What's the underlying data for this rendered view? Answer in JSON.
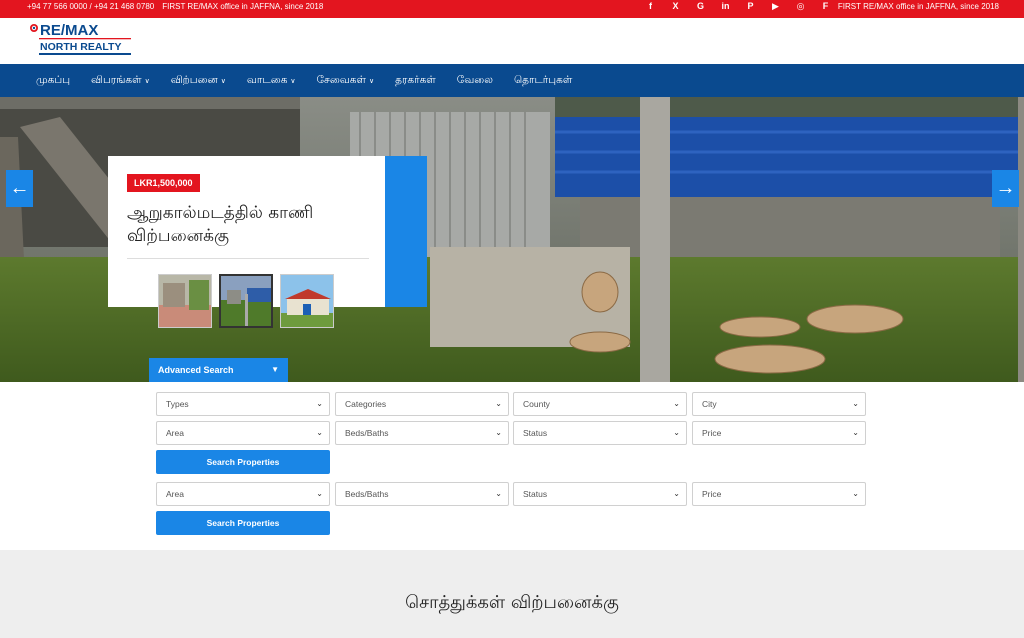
{
  "topbar": {
    "phones": "+94 77 566 0000 / +94 21 468 0780",
    "tagline_left": "FIRST RE/MAX office in JAFFNA, since 2018",
    "tagline_right": "FIRST RE/MAX office in JAFFNA, since 2018",
    "social": [
      "f",
      "X",
      "G",
      "in",
      "P",
      "▶",
      "◎",
      "F"
    ]
  },
  "logo": {
    "line1": "RE/MAX",
    "line2": "NORTH REALTY"
  },
  "nav": {
    "items": [
      {
        "label": "முகப்பு",
        "caret": false
      },
      {
        "label": "விபரங்கள்",
        "caret": true
      },
      {
        "label": "விற்பனை",
        "caret": true
      },
      {
        "label": "வாடகை",
        "caret": true
      },
      {
        "label": "சேவைகள்",
        "caret": true
      },
      {
        "label": "தரகர்கள்",
        "caret": false
      },
      {
        "label": "வேலை",
        "caret": false
      },
      {
        "label": "தொடர்புகள்",
        "caret": false
      }
    ]
  },
  "hero": {
    "price": "LKR1,500,000",
    "title": "ஆறுகால்மடத்தில் காணி விற்பனைக்கு",
    "prev_icon": "arrow-left-icon",
    "next_icon": "arrow-right-icon"
  },
  "search": {
    "toggle_label": "Advanced Search",
    "row1": [
      "Types",
      "Categories",
      "County",
      "City"
    ],
    "row2": [
      "Area",
      "Beds/Baths",
      "Status",
      "Price"
    ],
    "row3": [
      "Area",
      "Beds/Baths",
      "Status",
      "Price"
    ],
    "button_label": "Search Properties"
  },
  "section": {
    "title": "சொத்துக்கள் விற்பனைக்கு"
  },
  "colors": {
    "brand_red": "#e3151f",
    "nav_blue": "#0a4a8f",
    "accent_blue": "#1a86e6"
  }
}
